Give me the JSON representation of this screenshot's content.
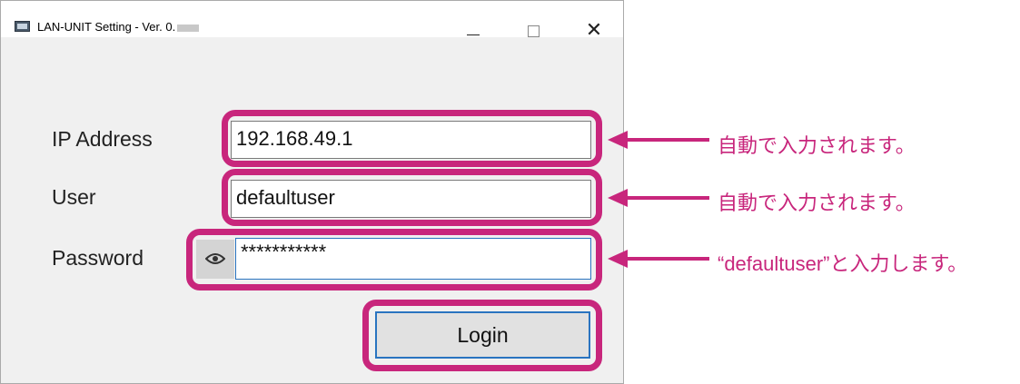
{
  "window": {
    "title": "LAN-UNIT Setting - Ver. 0.",
    "minimize_glyph": "—",
    "maximize_glyph": "□",
    "close_glyph": "✕"
  },
  "form": {
    "ip_label": "IP Address",
    "ip_value": "192.168.49.1",
    "user_label": "User",
    "user_value": "defaultuser",
    "password_label": "Password",
    "password_value": "***********",
    "reveal_icon": "eye-icon",
    "login_label": "Login"
  },
  "annotations": {
    "ip_note": "自動で入力されます。",
    "user_note": "自動で入力されます。",
    "password_note": "“defaultuser”と入力します。"
  },
  "colors": {
    "highlight": "#c8267c",
    "focus_border": "#2a74c0",
    "window_bg": "#f0f0f0"
  }
}
